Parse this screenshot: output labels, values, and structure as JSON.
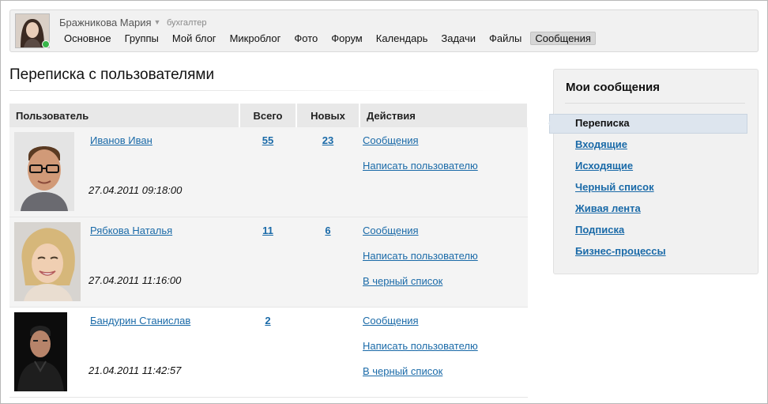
{
  "header": {
    "user_name": "Бражникова Мария",
    "user_role": "бухгалтер",
    "menu": [
      {
        "label": "Основное"
      },
      {
        "label": "Группы"
      },
      {
        "label": "Мой блог"
      },
      {
        "label": "Микроблог"
      },
      {
        "label": "Фото"
      },
      {
        "label": "Форум"
      },
      {
        "label": "Календарь"
      },
      {
        "label": "Задачи"
      },
      {
        "label": "Файлы"
      },
      {
        "label": "Сообщения",
        "active": true
      }
    ]
  },
  "page": {
    "title": "Переписка с пользователями"
  },
  "table": {
    "columns": {
      "user": "Пользователь",
      "total": "Всего",
      "new": "Новых",
      "actions": "Действия"
    },
    "rows": [
      {
        "name": "Иванов Иван",
        "date": "27.04.2011 09:18:00",
        "total": "55",
        "new": "23",
        "actions": [
          "Сообщения",
          "Написать пользователю"
        ]
      },
      {
        "name": "Рябкова Наталья",
        "date": "27.04.2011 11:16:00",
        "total": "11",
        "new": "6",
        "actions": [
          "Сообщения",
          "Написать пользователю",
          "В черный список"
        ]
      },
      {
        "name": "Бандурин Станислав",
        "date": "21.04.2011 11:42:57",
        "total": "2",
        "new": "",
        "actions": [
          "Сообщения",
          "Написать пользователю",
          "В черный список"
        ]
      }
    ]
  },
  "sidebar": {
    "title": "Мои сообщения",
    "items": [
      {
        "label": "Переписка",
        "active": true
      },
      {
        "label": "Входящие"
      },
      {
        "label": "Исходящие"
      },
      {
        "label": "Черный список"
      },
      {
        "label": "Живая лента"
      },
      {
        "label": "Подписка"
      },
      {
        "label": "Бизнес-процессы"
      }
    ]
  },
  "colors": {
    "link": "#1a6aa8",
    "online": "#39b54a",
    "header_bg": "#e8e8e8"
  }
}
